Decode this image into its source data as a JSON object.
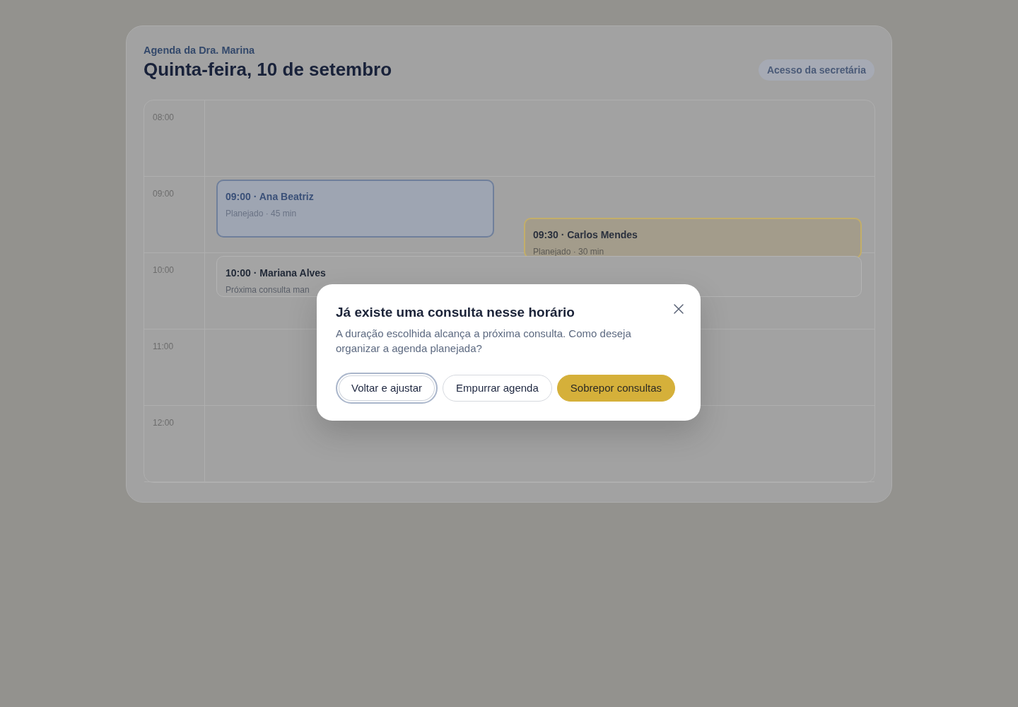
{
  "header": {
    "subtitle": "Agenda da Dra. Marina",
    "title": "Quinta-feira, 10 de setembro",
    "access_tag": "Acesso da secretária"
  },
  "schedule": {
    "hours": [
      "08:00",
      "09:00",
      "10:00",
      "11:00",
      "12:00"
    ],
    "appointments": [
      {
        "title": "09:00 · Ana Beatriz",
        "detail": "Planejado · 45 min",
        "kind": "editing"
      },
      {
        "title": "09:30 · Carlos Mendes",
        "detail": "Planejado · 30 min",
        "kind": "conflict"
      },
      {
        "title": "10:00 · Mariana Alves",
        "detail": "Próxima consulta man",
        "kind": "booked"
      }
    ]
  },
  "dialog": {
    "title": "Já existe uma consulta nesse horário",
    "message": "A duração escolhida alcança a próxima consulta. Como deseja organizar a agenda planejada?",
    "buttons": [
      {
        "label": "Voltar e ajustar",
        "kind": "outline",
        "focused": true
      },
      {
        "label": "Empurrar agenda",
        "kind": "outline",
        "focused": false
      },
      {
        "label": "Sobrepor consultas",
        "kind": "primary",
        "focused": false
      }
    ]
  }
}
